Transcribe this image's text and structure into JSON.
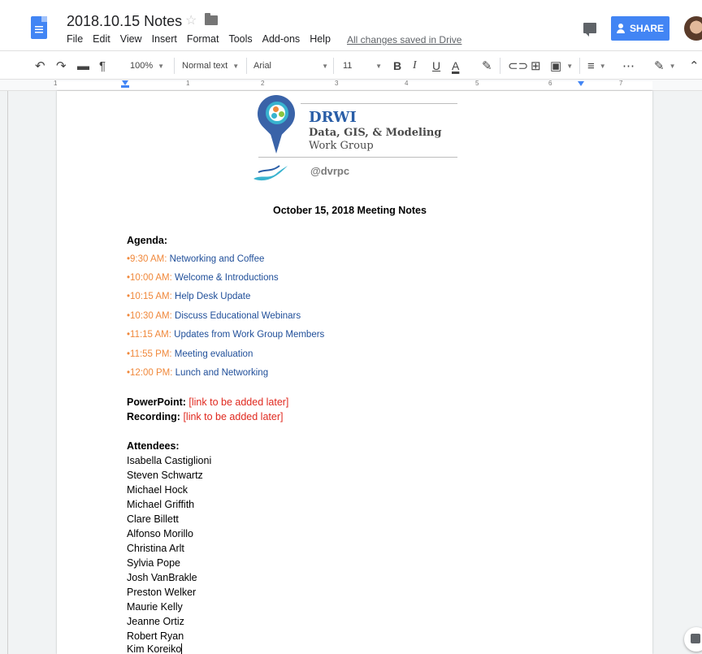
{
  "header": {
    "doc_title": "2018.10.15 Notes",
    "saved_status": "All changes saved in Drive",
    "share_label": "SHARE",
    "menu": [
      "File",
      "Edit",
      "View",
      "Insert",
      "Format",
      "Tools",
      "Add-ons",
      "Help"
    ]
  },
  "toolbar": {
    "zoom": "100%",
    "style": "Normal text",
    "font": "Arial",
    "size": "11"
  },
  "ruler": {
    "numbers": [
      "1",
      "1",
      "2",
      "3",
      "4",
      "5",
      "6",
      "7"
    ]
  },
  "logo": {
    "title": "DRWI",
    "line1": "Data, GIS, & Modeling",
    "line2": "Work Group",
    "org": "dvrpc"
  },
  "doc": {
    "heading": "October 15, 2018 Meeting Notes",
    "agenda_title": "Agenda:",
    "agenda": [
      {
        "bullet": "•",
        "time": "9:30 AM: ",
        "desc": "Networking and Coffee"
      },
      {
        "bullet": "•",
        "time": "10:00 AM: ",
        "desc": "Welcome & Introductions"
      },
      {
        "bullet": "•",
        "time": "10:15 AM: ",
        "desc": "Help Desk Update"
      },
      {
        "bullet": "•",
        "time": "10:30 AM: ",
        "desc": "Discuss Educational Webinars"
      },
      {
        "bullet": "•",
        "time": "11:15 AM: ",
        "desc": "Updates from Work Group Members"
      },
      {
        "bullet": "•",
        "time": "11:55 PM: ",
        "desc": "Meeting evaluation"
      },
      {
        "bullet": "•",
        "time": "12:00 PM: ",
        "desc": "Lunch and Networking"
      }
    ],
    "powerpoint_label": "PowerPoint: ",
    "powerpoint_value": "[link to be added later]",
    "recording_label": "Recording: ",
    "recording_value": "[link to be added later]",
    "attendees_title": "Attendees:",
    "attendees": [
      "Isabella Castiglioni",
      "Steven Schwartz",
      "Michael Hock",
      "Michael Griffith",
      "Clare Billett",
      "Alfonso Morillo",
      "Christina Arlt",
      "Sylvia Pope",
      "Josh VanBrakle",
      "Preston Welker",
      "Maurie Kelly",
      "Jeanne Ortiz",
      "Robert Ryan",
      "Kim Koreiko"
    ]
  },
  "colors": {
    "accent": "#4285f4",
    "agenda_time": "#f0883b",
    "agenda_desc": "#1f4e99",
    "link_red": "#e0291f",
    "logo_blue": "#2a5ea7"
  }
}
